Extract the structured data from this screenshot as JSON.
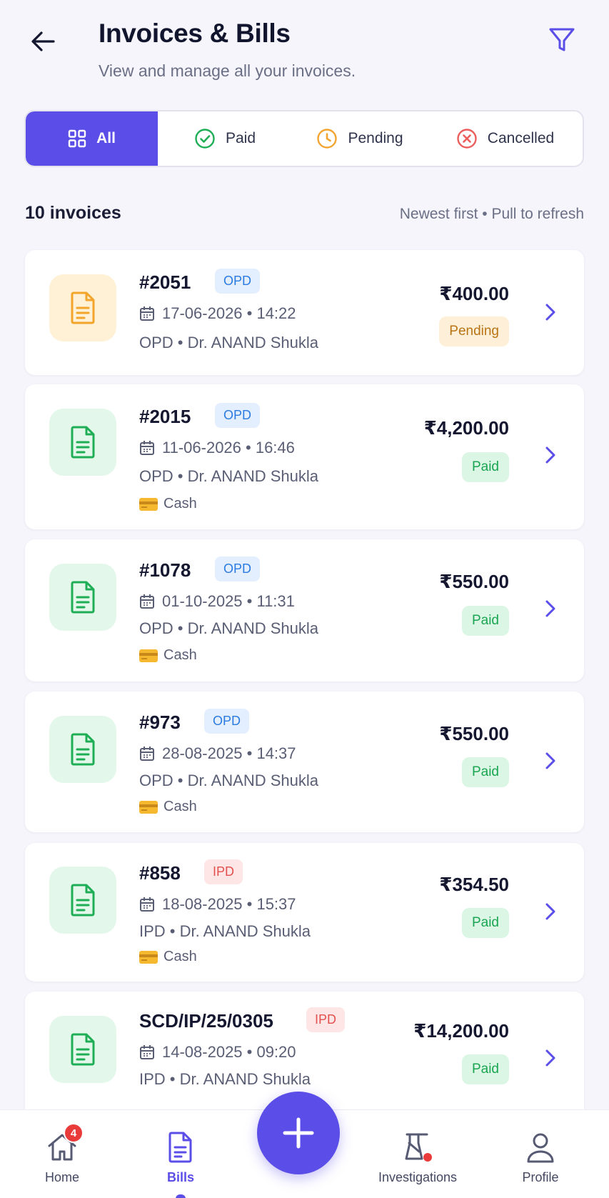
{
  "header": {
    "title": "Invoices & Bills",
    "subtitle": "View and manage all your invoices."
  },
  "tabs": [
    {
      "label": "All",
      "icon": "grid-icon",
      "active": true
    },
    {
      "label": "Paid",
      "icon": "check-circle-icon"
    },
    {
      "label": "Pending",
      "icon": "clock-icon"
    },
    {
      "label": "Cancelled",
      "icon": "x-circle-icon"
    }
  ],
  "list": {
    "count_label": "10 invoices",
    "sort_hint": "Newest first • Pull to refresh"
  },
  "invoices": [
    {
      "number": "#2051",
      "type": "OPD",
      "date": "17-06-2026 • 14:22",
      "doctor": "OPD • Dr. ANAND Shukla",
      "payment": "",
      "amount": "₹400.00",
      "status": "Pending"
    },
    {
      "number": "#2015",
      "type": "OPD",
      "date": "11-06-2026 • 16:46",
      "doctor": "OPD • Dr. ANAND Shukla",
      "payment": "Cash",
      "amount": "₹4,200.00",
      "status": "Paid"
    },
    {
      "number": "#1078",
      "type": "OPD",
      "date": "01-10-2025 • 11:31",
      "doctor": "OPD • Dr. ANAND Shukla",
      "payment": "Cash",
      "amount": "₹550.00",
      "status": "Paid"
    },
    {
      "number": "#973",
      "type": "OPD",
      "date": "28-08-2025 • 14:37",
      "doctor": "OPD • Dr. ANAND Shukla",
      "payment": "Cash",
      "amount": "₹550.00",
      "status": "Paid"
    },
    {
      "number": "#858",
      "type": "IPD",
      "date": "18-08-2025 • 15:37",
      "doctor": "IPD • Dr. ANAND Shukla",
      "payment": "Cash",
      "amount": "₹354.50",
      "status": "Paid"
    },
    {
      "number": "SCD/IP/25/0305",
      "type": "IPD",
      "date": "14-08-2025 • 09:20",
      "doctor": "IPD • Dr. ANAND Shukla",
      "payment": "",
      "amount": "₹14,200.00",
      "status": "Paid"
    }
  ],
  "nav": {
    "home": "Home",
    "home_badge": "4",
    "bills": "Bills",
    "investigations": "Investigations",
    "profile": "Profile"
  },
  "colors": {
    "accent": "#5b4ee8",
    "paid": "#1aa552",
    "pending": "#b97514",
    "cancelled": "#e2504f"
  }
}
